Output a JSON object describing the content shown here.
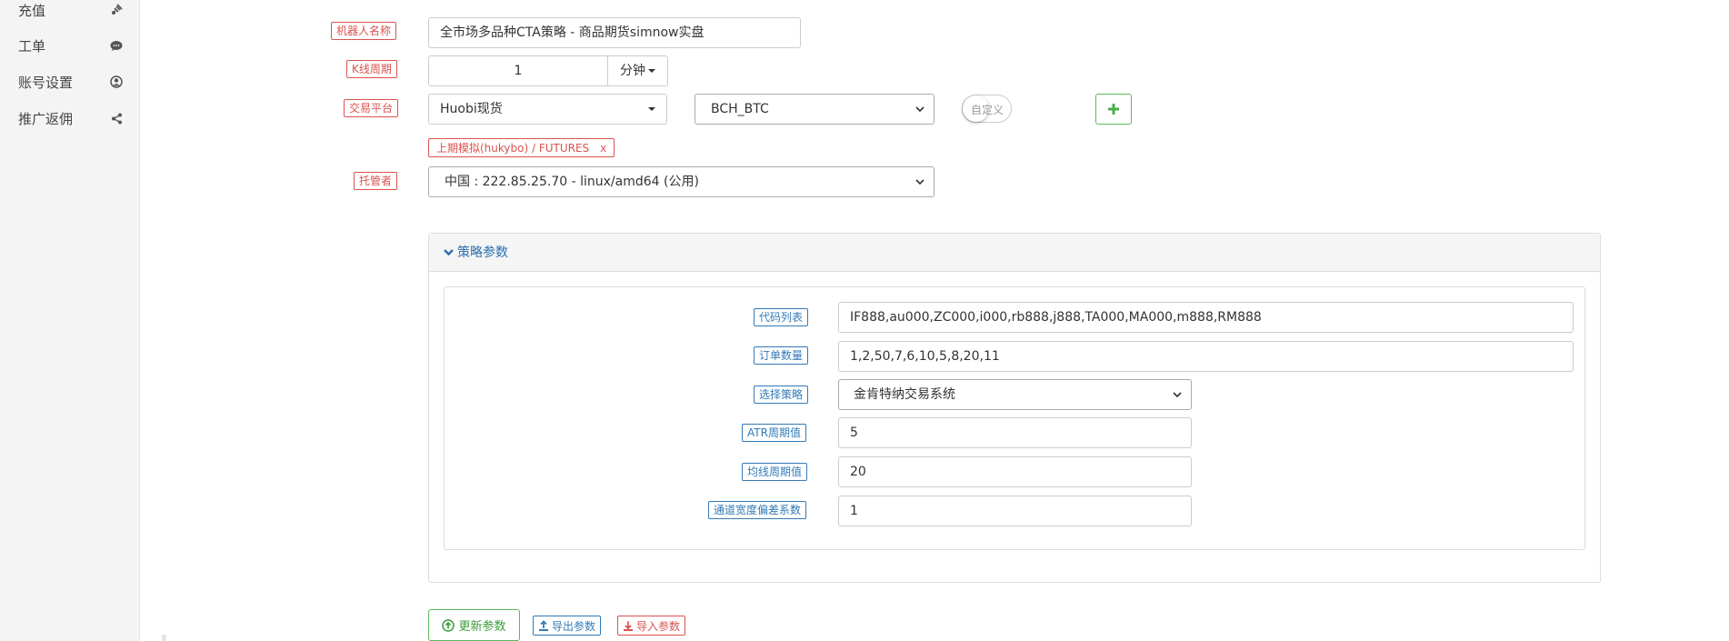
{
  "sidebar": {
    "items": [
      {
        "label": "充值",
        "icon": "plug-icon"
      },
      {
        "label": "工单",
        "icon": "chat-icon"
      },
      {
        "label": "账号设置",
        "icon": "user-circle-icon"
      },
      {
        "label": "推广返佣",
        "icon": "share-icon"
      }
    ]
  },
  "form": {
    "robot_name_label": "机器人名称",
    "robot_name_value": "全市场多品种CTA策略 - 商品期货simnow实盘",
    "kline_label": "K线周期",
    "kline_value": "1",
    "kline_unit": "分钟",
    "exchange_label": "交易平台",
    "exchange_value": "Huobi现货",
    "pair_value": "BCH_BTC",
    "custom_toggle_label": "自定义",
    "exchange_tag": "上期模拟(hukybo) / FUTURES",
    "exchange_tag_close": "x",
    "custodian_label": "托管者",
    "custodian_value": "中国 : 222.85.25.70 - linux/amd64 (公用)"
  },
  "params": {
    "title": "策略参数",
    "rows": [
      {
        "label": "代码列表",
        "value": "IF888,au000,ZC000,i000,rb888,j888,TA000,MA000,m888,RM888"
      },
      {
        "label": "订单数量",
        "value": "1,2,50,7,6,10,5,8,20,11"
      },
      {
        "label": "选择策略",
        "value": "金肯特纳交易系统"
      },
      {
        "label": "ATR周期值",
        "value": "5"
      },
      {
        "label": "均线周期值",
        "value": "20"
      },
      {
        "label": "通道宽度偏差系数",
        "value": "1"
      }
    ]
  },
  "actions": {
    "update_label": "更新参数",
    "export_label": "导出参数",
    "import_label": "导入参数"
  },
  "colors": {
    "red": "#d9534f",
    "blue": "#337ab7",
    "green": "#5cb85c"
  }
}
